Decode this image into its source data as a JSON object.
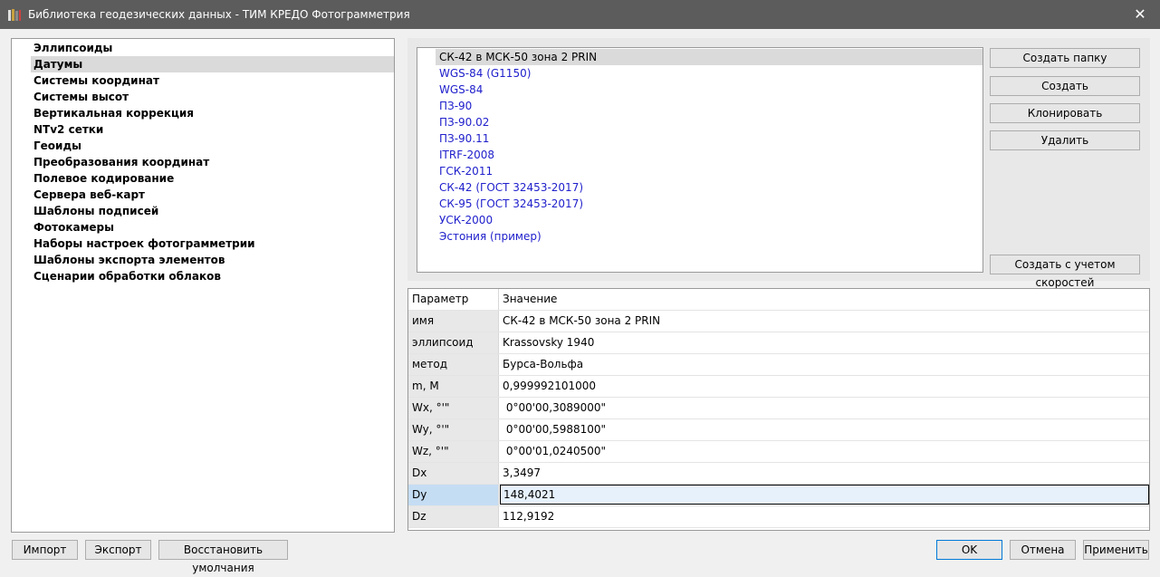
{
  "window": {
    "title": "Библиотека геодезических данных - ТИМ КРЕДО Фотограмметрия",
    "close_glyph": "✕"
  },
  "sidebar": {
    "items": [
      {
        "label": "Эллипсоиды"
      },
      {
        "label": "Датумы",
        "selected": true
      },
      {
        "label": "Системы координат"
      },
      {
        "label": "Системы высот"
      },
      {
        "label": "Вертикальная коррекция"
      },
      {
        "label": "NTv2 сетки"
      },
      {
        "label": "Геоиды"
      },
      {
        "label": "Преобразования координат"
      },
      {
        "label": "Полевое кодирование"
      },
      {
        "label": "Сервера веб-карт"
      },
      {
        "label": "Шаблоны подписей"
      },
      {
        "label": "Фотокамеры"
      },
      {
        "label": "Наборы настроек фотограмметрии"
      },
      {
        "label": "Шаблоны экспорта элементов"
      },
      {
        "label": "Сценарии обработки облаков"
      }
    ]
  },
  "datums": {
    "items": [
      {
        "label": "СК-42 в МСК-50 зона 2 PRIN",
        "selected": true
      },
      {
        "label": "WGS-84 (G1150)"
      },
      {
        "label": "WGS-84"
      },
      {
        "label": "ПЗ-90"
      },
      {
        "label": "ПЗ-90.02"
      },
      {
        "label": "ПЗ-90.11"
      },
      {
        "label": "ITRF-2008"
      },
      {
        "label": "ГСК-2011"
      },
      {
        "label": "СК-42 (ГОСТ 32453-2017)"
      },
      {
        "label": "СК-95 (ГОСТ 32453-2017)"
      },
      {
        "label": "УСК-2000"
      },
      {
        "label": "Эстония (пример)"
      }
    ]
  },
  "actions": {
    "create_folder": "Создать папку",
    "create": "Создать",
    "clone": "Клонировать",
    "delete": "Удалить",
    "create_with_velocities": "Создать с учетом скоростей"
  },
  "properties": {
    "header": {
      "param": "Параметр",
      "value": "Значение"
    },
    "rows": [
      {
        "param": "имя",
        "value": "СК-42 в МСК-50 зона 2 PRIN"
      },
      {
        "param": "эллипсоид",
        "value": "Krassovsky 1940"
      },
      {
        "param": "метод",
        "value": "Бурса-Вольфа"
      },
      {
        "param": "m, M",
        "value": "0,999992101000"
      },
      {
        "param": "Wx, °'\"",
        "value": " 0°00'00,3089000\""
      },
      {
        "param": "Wy, °'\"",
        "value": " 0°00'00,5988100\""
      },
      {
        "param": "Wz, °'\"",
        "value": " 0°00'01,0240500\""
      },
      {
        "param": "Dx",
        "value": "3,3497"
      },
      {
        "param": "Dy",
        "value": "148,4021",
        "active": true
      },
      {
        "param": "Dz",
        "value": "112,9192"
      }
    ]
  },
  "footer": {
    "import": "Импорт",
    "export": "Экспорт",
    "restore_defaults": "Восстановить умолчания",
    "ok": "OK",
    "cancel": "Отмена",
    "apply": "Применить"
  }
}
